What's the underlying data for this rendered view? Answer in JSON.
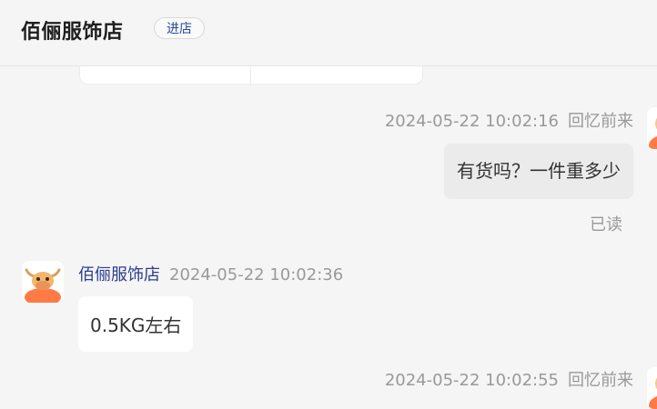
{
  "header": {
    "shop_name": "佰俪服饰店",
    "enter_label": "进店"
  },
  "messages": [
    {
      "side": "right",
      "timestamp": "2024-05-22 10:02:16",
      "sender": "回忆前来",
      "text": "有货吗？一件重多少",
      "status": "已读"
    },
    {
      "side": "left",
      "timestamp": "2024-05-22 10:02:36",
      "sender": "佰俪服饰店",
      "text": "0.5KG左右"
    },
    {
      "side": "right",
      "timestamp": "2024-05-22 10:02:55",
      "sender": "回忆前来"
    }
  ],
  "colors": {
    "background": "#f5f5f5",
    "bubble_mine": "#ebebeb",
    "bubble_theirs": "#ffffff",
    "shop_name_link": "#2b3d8f",
    "avatar_orange": "#ff7a45"
  },
  "icons": {
    "shop_avatar": "bull-mascot-avatar-icon",
    "user_avatar": "user-avatar-icon"
  }
}
